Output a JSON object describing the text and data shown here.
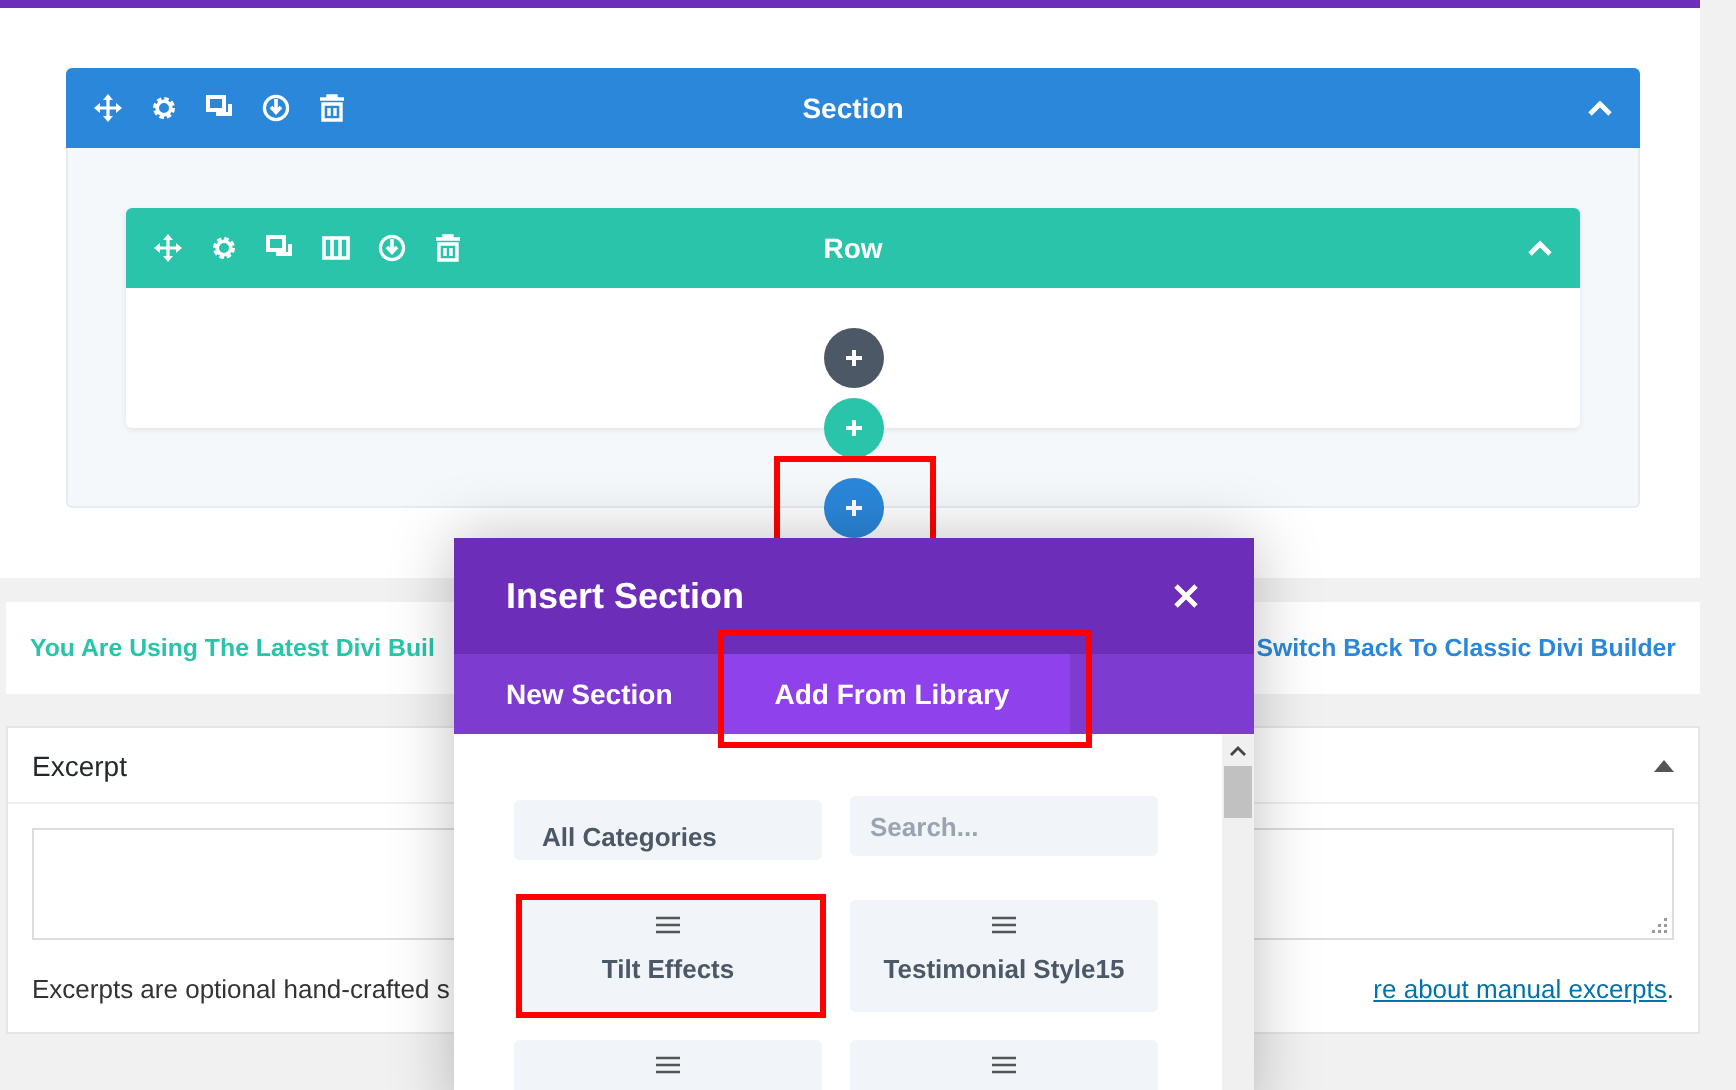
{
  "builder": {
    "section": {
      "title": "Section",
      "expanded": true
    },
    "row": {
      "title": "Row",
      "expanded": true
    },
    "add_buttons": [
      {
        "kind": "module",
        "highlighted": false
      },
      {
        "kind": "row",
        "highlighted": false
      },
      {
        "kind": "section",
        "highlighted": true
      }
    ]
  },
  "notice": {
    "message": "You Are Using The Latest Divi Buil",
    "link": "Switch Back To Classic Divi Builder"
  },
  "excerpt": {
    "title": "Excerpt",
    "expanded": true,
    "help_text": "Excerpts are optional hand-crafted s",
    "help_link": "re about manual excerpts",
    "help_end": "."
  },
  "modal": {
    "title": "Insert Section",
    "tabs": [
      {
        "label": "New Section",
        "selected": false,
        "highlighted": false
      },
      {
        "label": "Add From Library",
        "selected": true,
        "highlighted": true
      }
    ],
    "category": "All Categories",
    "search_placeholder": "Search...",
    "items": [
      {
        "label": "Tilt Effects",
        "highlighted": true
      },
      {
        "label": "Testimonial Style15",
        "highlighted": false
      },
      {
        "highlighted": false
      },
      {
        "highlighted": false
      }
    ]
  }
}
